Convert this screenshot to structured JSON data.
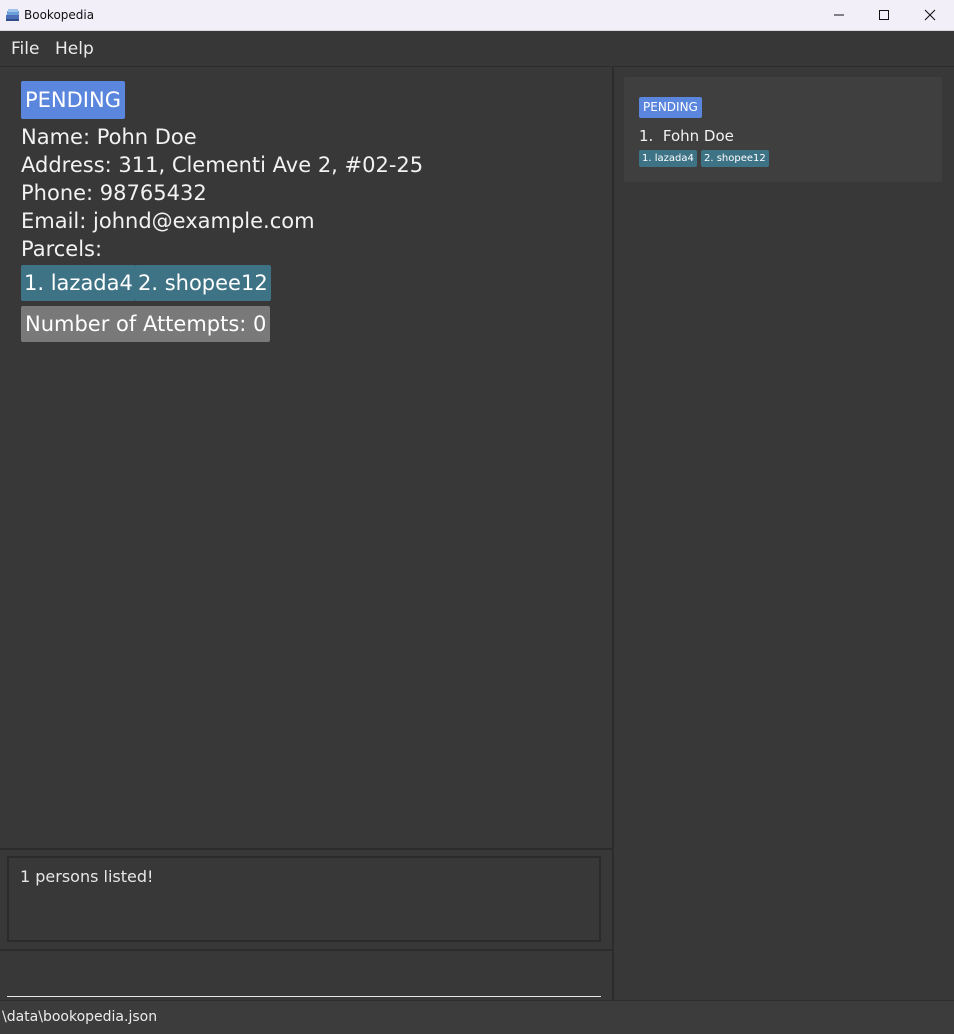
{
  "window": {
    "title": "Bookopedia",
    "icon": "book-stack-icon",
    "minimize_icon": "minimize-icon",
    "maximize_icon": "maximize-icon",
    "close_icon": "close-icon"
  },
  "menu": {
    "items": [
      {
        "label": "File"
      },
      {
        "label": "Help"
      }
    ]
  },
  "detail": {
    "status": "PENDING",
    "name": "Name: Pohn Doe",
    "address": "Address: 311, Clementi Ave 2, #02-25",
    "phone": "Phone: 98765432",
    "email": "Email: johnd@example.com",
    "parcels_label": "Parcels:",
    "parcels": [
      "1. lazada4",
      "2. shopee12"
    ],
    "attempts": "Number of Attempts: 0"
  },
  "list": {
    "cards": [
      {
        "status": "PENDING",
        "index": "1.",
        "name": "Fohn Doe",
        "parcels": [
          "1. lazada4",
          "2. shopee12"
        ]
      }
    ]
  },
  "result": {
    "message": "1 persons listed!"
  },
  "command": {
    "value": "",
    "placeholder": ""
  },
  "statusbar": {
    "path": "\\data\\bookopedia.json"
  },
  "colors": {
    "status_pending": "#5b86dd",
    "parcel_tag": "#3e7386",
    "attempts_tag": "#797979",
    "background": "#383838"
  }
}
